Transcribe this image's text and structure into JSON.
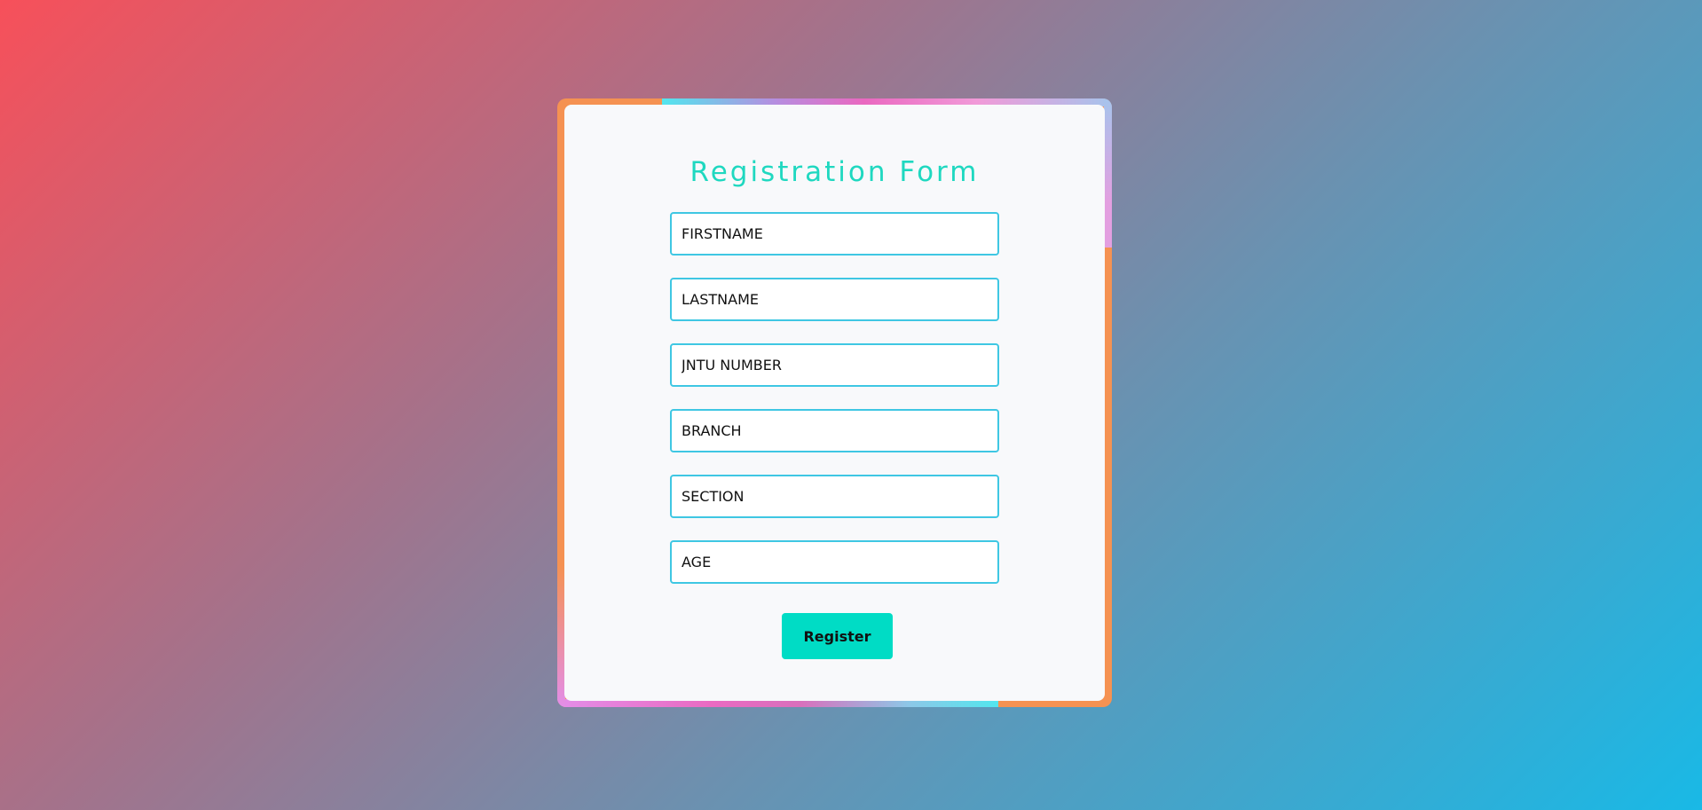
{
  "form": {
    "title": "Registration Form",
    "fields": [
      {
        "placeholder": "FIRSTNAME",
        "value": ""
      },
      {
        "placeholder": "LASTNAME",
        "value": ""
      },
      {
        "placeholder": "JNTU NUMBER",
        "value": ""
      },
      {
        "placeholder": "BRANCH",
        "value": ""
      },
      {
        "placeholder": "SECTION",
        "value": ""
      },
      {
        "placeholder": "AGE",
        "value": ""
      }
    ],
    "submit_label": "Register"
  },
  "colors": {
    "title": "#1fd8c0",
    "button": "#00dcc5",
    "input_border": "#3fc7e3",
    "frame": "#f59252",
    "card_background": "#f8f9fb"
  }
}
